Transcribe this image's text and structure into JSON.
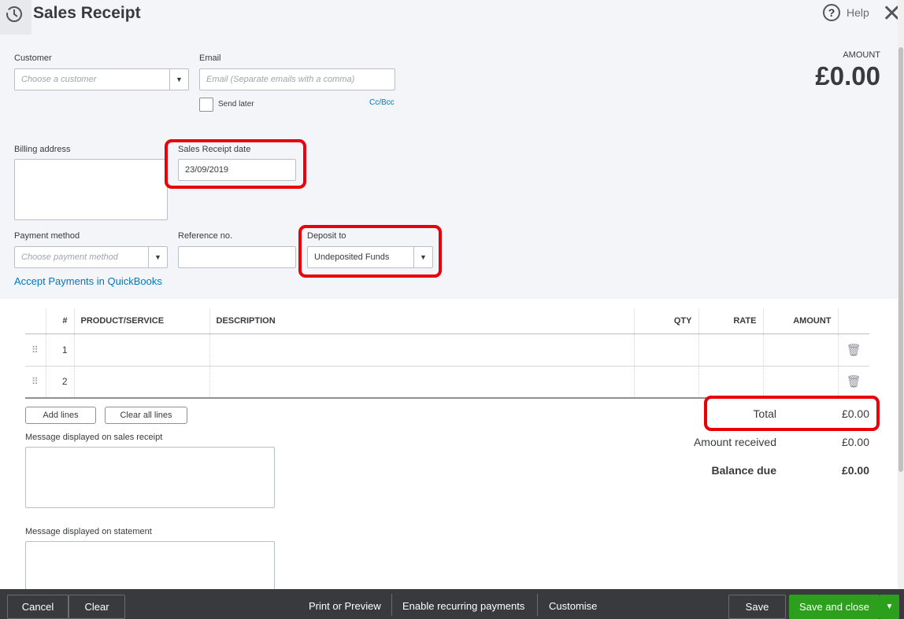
{
  "header": {
    "title": "Sales Receipt",
    "help": "Help"
  },
  "form": {
    "customer_label": "Customer",
    "customer_placeholder": "Choose a customer",
    "email_label": "Email",
    "email_placeholder": "Email (Separate emails with a comma)",
    "send_later": "Send later",
    "ccbcc": "Cc/Bcc",
    "amount_label": "AMOUNT",
    "amount_value": "£0.00",
    "billing_label": "Billing address",
    "date_label": "Sales Receipt date",
    "date_value": "23/09/2019",
    "payment_label": "Payment method",
    "payment_placeholder": "Choose payment method",
    "ref_label": "Reference no.",
    "deposit_label": "Deposit to",
    "deposit_value": "Undeposited Funds",
    "accept_link": "Accept Payments in QuickBooks"
  },
  "table": {
    "headers": [
      "#",
      "PRODUCT/SERVICE",
      "DESCRIPTION",
      "QTY",
      "RATE",
      "AMOUNT"
    ],
    "rows": [
      "1",
      "2"
    ]
  },
  "actions": {
    "add_lines": "Add lines",
    "clear_lines": "Clear all lines"
  },
  "messages": {
    "receipt": "Message displayed on sales receipt",
    "statement": "Message displayed on statement"
  },
  "totals": {
    "total_label": "Total",
    "total": "£0.00",
    "received_label": "Amount received",
    "received": "£0.00",
    "balance_label": "Balance due",
    "balance": "£0.00"
  },
  "footer": {
    "cancel": "Cancel",
    "clear": "Clear",
    "print": "Print or Preview",
    "recurring": "Enable recurring payments",
    "customise": "Customise",
    "save": "Save",
    "save_close": "Save and close"
  }
}
